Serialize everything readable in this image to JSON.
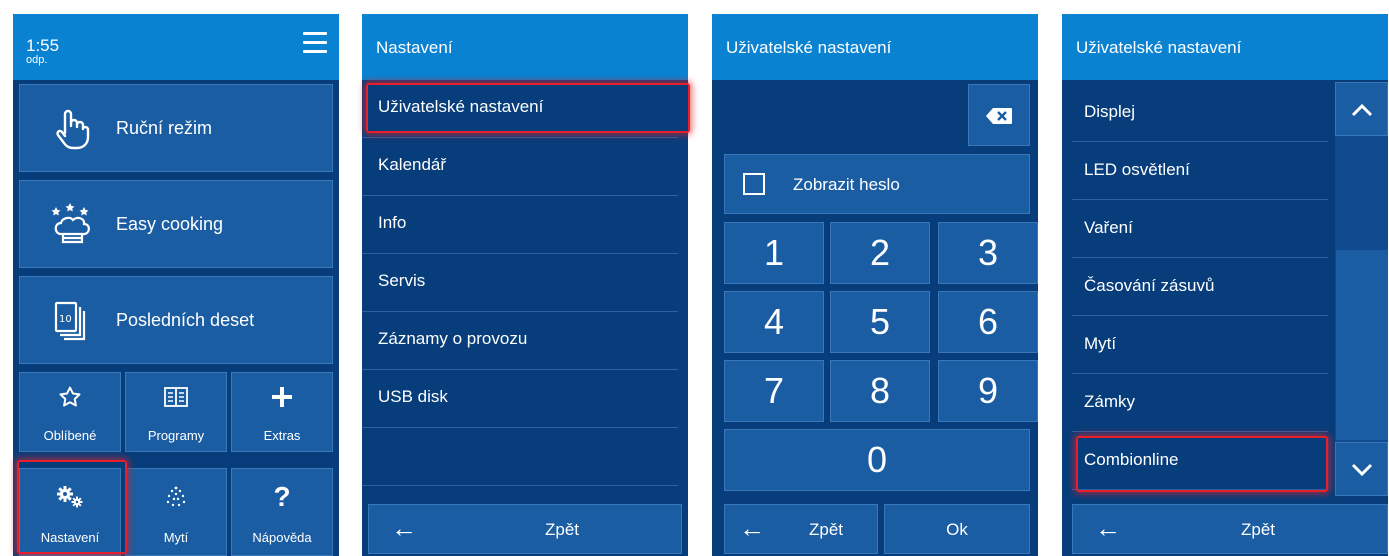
{
  "panel1": {
    "clock_time": "1:55",
    "clock_sub": "odp.",
    "menu_icon": "hamburger-icon",
    "big_buttons": [
      {
        "label": "Ruční režim",
        "icon": "hand-pointer-icon"
      },
      {
        "label": "Easy cooking",
        "icon": "chef-hat-stars-icon"
      },
      {
        "label": "Posledních deset",
        "icon": "last-ten-icon"
      }
    ],
    "small_buttons": [
      {
        "label": "Oblíbené",
        "icon": "star-icon"
      },
      {
        "label": "Programy",
        "icon": "book-icon"
      },
      {
        "label": "Extras",
        "icon": "plus-icon"
      },
      {
        "label": "Nastavení",
        "icon": "gears-icon"
      },
      {
        "label": "Mytí",
        "icon": "spray-icon"
      },
      {
        "label": "Nápověda",
        "icon": "question-icon",
        "glyph": "?"
      }
    ]
  },
  "panel2": {
    "title": "Nastavení",
    "items": [
      "Uživatelské nastavení",
      "Kalendář",
      "Info",
      "Servis",
      "Záznamy o provozu",
      "USB disk"
    ],
    "back_label": "Zpět"
  },
  "panel3": {
    "title": "Uživatelské nastavení",
    "show_password_label": "Zobrazit heslo",
    "keys": [
      "1",
      "2",
      "3",
      "4",
      "5",
      "6",
      "7",
      "8",
      "9",
      "0"
    ],
    "back_label": "Zpět",
    "ok_label": "Ok"
  },
  "panel4": {
    "title": "Uživatelské nastavení",
    "items": [
      "Displej",
      "LED osvětlení",
      "Vaření",
      "Časování zásuvů",
      "Mytí",
      "Zámky",
      "Combionline"
    ],
    "back_label": "Zpět"
  },
  "colors": {
    "header": "#0a82d2",
    "panel_bg": "#073d7a",
    "button_bg": "#1b5da3",
    "highlight": "#e5202a"
  }
}
